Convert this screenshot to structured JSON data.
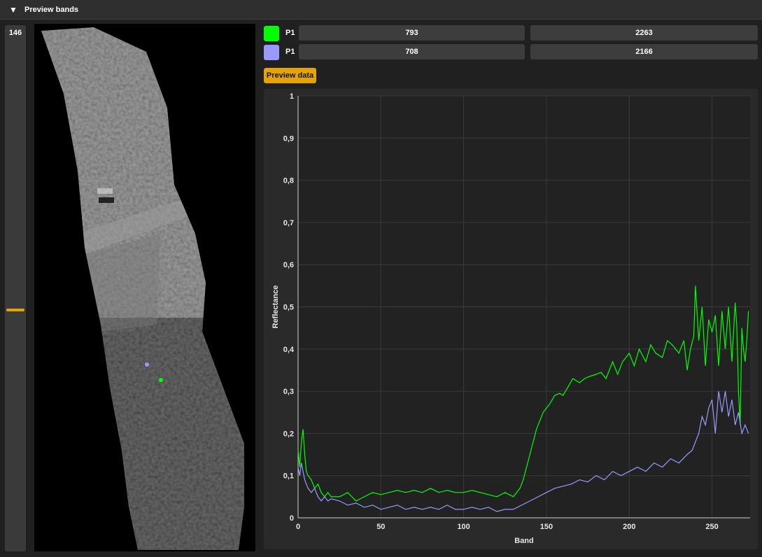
{
  "header": {
    "title": "Preview bands",
    "expand_icon": "triangle-down-icon"
  },
  "band_slider": {
    "value": "146",
    "fraction": 0.53
  },
  "points": [
    {
      "color": "#00ff00",
      "label": "P1",
      "x": "793",
      "y": "2263"
    },
    {
      "color": "#9999ff",
      "label": "P1",
      "x": "708",
      "y": "2166"
    }
  ],
  "preview_button": {
    "label": "Preview data"
  },
  "colors": {
    "accent": "#e6a400",
    "background": "#202020",
    "panel": "#2a2a2a"
  },
  "chart_data": {
    "type": "line",
    "xlabel": "Band",
    "ylabel": "Reflectance",
    "xlim": [
      0,
      273
    ],
    "ylim": [
      0,
      1
    ],
    "xticks": [
      0,
      50,
      100,
      150,
      200,
      250
    ],
    "xtick_labels": [
      "0",
      "50",
      "100",
      "150",
      "200",
      "250"
    ],
    "yticks": [
      0,
      0.1,
      0.2,
      0.3,
      0.4,
      0.5,
      0.6,
      0.7,
      0.8,
      0.9,
      1
    ],
    "ytick_labels": [
      "0",
      "0,1",
      "0,2",
      "0,3",
      "0,4",
      "0,5",
      "0,6",
      "0,7",
      "0,8",
      "0,9",
      "1"
    ],
    "grid": true,
    "series": [
      {
        "color": "#00ff00",
        "x": [
          0,
          1,
          2,
          3,
          4,
          5,
          6,
          8,
          10,
          12,
          14,
          16,
          18,
          20,
          25,
          30,
          35,
          40,
          45,
          50,
          55,
          60,
          65,
          70,
          75,
          80,
          85,
          90,
          95,
          100,
          105,
          110,
          115,
          120,
          125,
          130,
          132,
          134,
          136,
          138,
          140,
          142,
          144,
          146,
          148,
          150,
          152,
          155,
          158,
          160,
          163,
          166,
          170,
          173,
          176,
          180,
          183,
          186,
          190,
          193,
          196,
          200,
          203,
          206,
          210,
          213,
          216,
          220,
          223,
          226,
          230,
          233,
          235,
          237,
          239,
          240,
          242,
          244,
          246,
          248,
          250,
          252,
          254,
          256,
          258,
          260,
          262,
          264,
          265,
          266,
          267,
          268,
          269,
          270,
          271,
          272
        ],
        "y": [
          0.16,
          0.12,
          0.18,
          0.21,
          0.15,
          0.11,
          0.1,
          0.09,
          0.07,
          0.08,
          0.06,
          0.05,
          0.06,
          0.05,
          0.05,
          0.06,
          0.04,
          0.05,
          0.06,
          0.055,
          0.06,
          0.065,
          0.06,
          0.065,
          0.06,
          0.07,
          0.06,
          0.065,
          0.06,
          0.06,
          0.065,
          0.06,
          0.055,
          0.05,
          0.06,
          0.05,
          0.06,
          0.07,
          0.09,
          0.12,
          0.15,
          0.18,
          0.21,
          0.23,
          0.25,
          0.26,
          0.27,
          0.29,
          0.295,
          0.29,
          0.31,
          0.33,
          0.32,
          0.33,
          0.335,
          0.34,
          0.345,
          0.33,
          0.37,
          0.34,
          0.37,
          0.39,
          0.36,
          0.4,
          0.37,
          0.41,
          0.39,
          0.38,
          0.42,
          0.41,
          0.39,
          0.42,
          0.35,
          0.4,
          0.43,
          0.55,
          0.42,
          0.5,
          0.36,
          0.47,
          0.44,
          0.48,
          0.36,
          0.49,
          0.4,
          0.5,
          0.37,
          0.51,
          0.45,
          0.3,
          0.22,
          0.45,
          0.4,
          0.37,
          0.42,
          0.49
        ]
      },
      {
        "color": "#9999ff",
        "x": [
          0,
          1,
          2,
          3,
          4,
          5,
          6,
          8,
          10,
          12,
          14,
          16,
          18,
          20,
          25,
          30,
          35,
          40,
          45,
          50,
          55,
          60,
          65,
          70,
          75,
          80,
          85,
          90,
          95,
          100,
          105,
          110,
          115,
          120,
          125,
          130,
          135,
          140,
          145,
          150,
          155,
          160,
          165,
          170,
          175,
          180,
          185,
          190,
          195,
          200,
          205,
          210,
          215,
          220,
          225,
          230,
          235,
          238,
          240,
          242,
          244,
          246,
          248,
          250,
          252,
          254,
          256,
          258,
          260,
          262,
          264,
          266,
          268,
          270,
          272
        ],
        "y": [
          0.12,
          0.1,
          0.13,
          0.11,
          0.09,
          0.08,
          0.07,
          0.06,
          0.07,
          0.05,
          0.04,
          0.05,
          0.04,
          0.045,
          0.04,
          0.03,
          0.035,
          0.025,
          0.03,
          0.02,
          0.025,
          0.03,
          0.02,
          0.025,
          0.02,
          0.025,
          0.02,
          0.03,
          0.02,
          0.02,
          0.025,
          0.02,
          0.025,
          0.015,
          0.02,
          0.02,
          0.03,
          0.04,
          0.05,
          0.06,
          0.07,
          0.075,
          0.08,
          0.09,
          0.085,
          0.1,
          0.09,
          0.11,
          0.1,
          0.11,
          0.12,
          0.11,
          0.13,
          0.12,
          0.14,
          0.13,
          0.15,
          0.16,
          0.18,
          0.2,
          0.24,
          0.22,
          0.26,
          0.28,
          0.2,
          0.3,
          0.25,
          0.3,
          0.24,
          0.28,
          0.22,
          0.25,
          0.2,
          0.22,
          0.2
        ]
      }
    ]
  }
}
